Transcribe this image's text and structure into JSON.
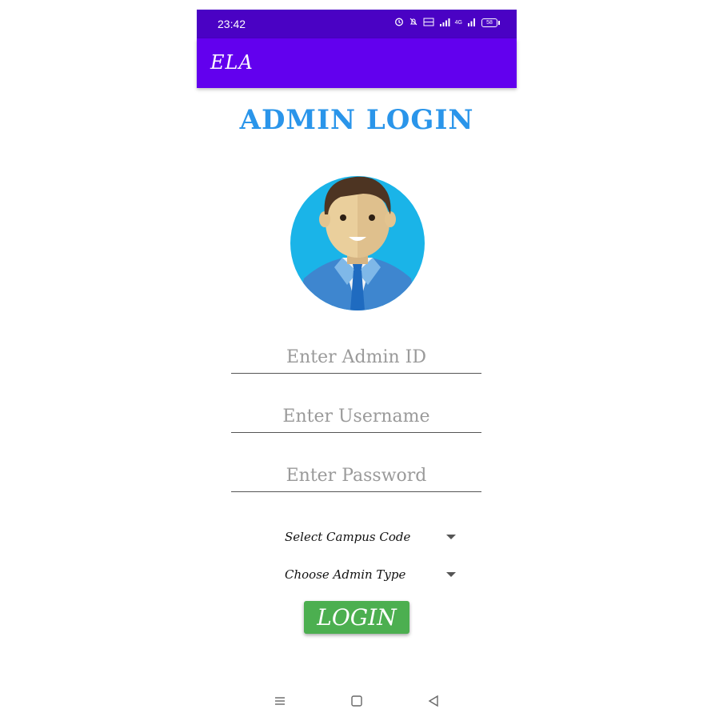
{
  "status_bar": {
    "time": "23:42",
    "network_label": "4G",
    "battery_level": "58"
  },
  "app_bar": {
    "title": "ELA"
  },
  "screen": {
    "heading": "ADMIN LOGIN"
  },
  "form": {
    "admin_id_placeholder": "Enter Admin ID",
    "username_placeholder": "Enter Username",
    "password_placeholder": "Enter Password",
    "campus_code_label": "Select Campus Code",
    "admin_type_label": "Choose Admin Type",
    "login_label": "LOGIN"
  },
  "navigation": {
    "recent_icon": "menu-lines-icon",
    "home_icon": "square-icon",
    "back_icon": "triangle-back-icon"
  },
  "colors": {
    "status_bar": "#4a02c4",
    "app_bar": "#6200ee",
    "heading": "#2a95ea",
    "login_button": "#4caf50"
  }
}
